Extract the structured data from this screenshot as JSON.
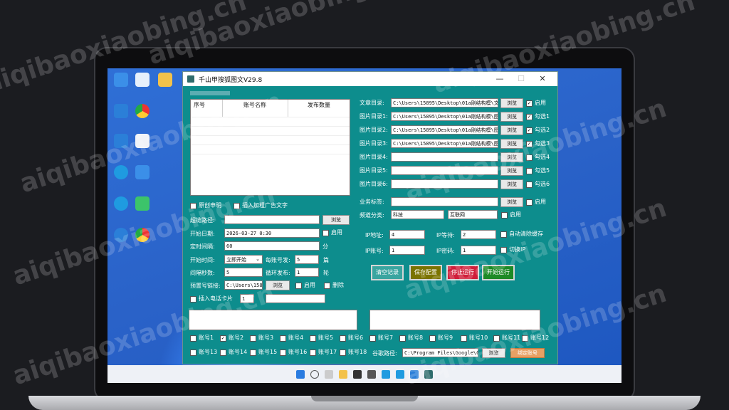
{
  "watermark": "aiqibaoxiaobing.cn",
  "window": {
    "title": "千山甲搜狐图文V29.8",
    "minimize": "—",
    "maximize": "☐",
    "close": "✕"
  },
  "table": {
    "headers": [
      "序号",
      "账号名称",
      "发布数量"
    ]
  },
  "left": {
    "original_label": "原创申明",
    "insert_ad_label": "插入加粗广告文字",
    "link_path_label": "超链路径:",
    "browse": "浏览",
    "start_date_label": "开始日期:",
    "start_date_value": "2026-03-27  0:30",
    "enable": "启用",
    "timer_label": "定时间隔:",
    "timer_value": "60",
    "minute_unit": "分",
    "start_time_label": "开始时间:",
    "start_time_value": "立即开始",
    "per_account_label": "每账号发:",
    "per_account_value": "5",
    "piece_unit": "篇",
    "interval_label": "间隔秒数:",
    "interval_value": "5",
    "loop_label": "循环发布:",
    "loop_value": "1",
    "round_unit": "轮",
    "preset_link_label": "预置号链接:",
    "preset_link_value": "C:\\Users\\1589",
    "delete": "删除",
    "insert_phone_label": "插入电话卡片",
    "phone_value": "1"
  },
  "right": {
    "article_dir_label": "文章目录:",
    "article_dir_value": "C:\\Users\\15895\\Desktop\\01a刚结构模\\文",
    "img_dirs": [
      {
        "label": "图片目录1:",
        "value": "C:\\Users\\15895\\Desktop\\01a刚结构模\\图",
        "check": "勾选1",
        "on": true
      },
      {
        "label": "图片目录2:",
        "value": "C:\\Users\\15895\\Desktop\\01a刚结构模\\图",
        "check": "勾选2",
        "on": true
      },
      {
        "label": "图片目录3:",
        "value": "C:\\Users\\15895\\Desktop\\01a刚结构模\\图",
        "check": "勾选3",
        "on": true
      },
      {
        "label": "图片目录4:",
        "value": "",
        "check": "勾选4",
        "on": false
      },
      {
        "label": "图片目录5:",
        "value": "",
        "check": "勾选5",
        "on": false
      },
      {
        "label": "图片目录6:",
        "value": "",
        "check": "勾选6",
        "on": false
      }
    ],
    "tag_label": "业务标签:",
    "channel_label": "频道分类:",
    "channel_value1": "科技",
    "channel_value2": "互联网",
    "ip_addr_label": "IP地址:",
    "ip_addr_value": "4",
    "ip_wait_label": "IP等待:",
    "ip_wait_value": "2",
    "auto_clear_label": "自动清除缓存",
    "ip_account_label": "IP账号:",
    "ip_account_value": "1",
    "ip_password_label": "IP密码:",
    "ip_password_value": "1",
    "switch_ip_label": "切换IP",
    "btn_clear": "清空记录",
    "btn_save": "保存配置",
    "btn_stop": "停止运行",
    "btn_start": "开始运行",
    "colors": {
      "clear": "#3aa5a0",
      "save": "#7a7300",
      "stop": "#d01e3a",
      "start": "#1e8a26"
    }
  },
  "accounts": [
    {
      "label": "账号1",
      "on": false
    },
    {
      "label": "账号2",
      "on": true
    },
    {
      "label": "账号3",
      "on": false
    },
    {
      "label": "账号4",
      "on": false
    },
    {
      "label": "账号5",
      "on": false
    },
    {
      "label": "账号6",
      "on": false
    },
    {
      "label": "账号7",
      "on": false
    },
    {
      "label": "账号8",
      "on": false
    },
    {
      "label": "账号9",
      "on": false
    },
    {
      "label": "账号10",
      "on": false
    },
    {
      "label": "账号11",
      "on": false
    },
    {
      "label": "账号12",
      "on": false
    },
    {
      "label": "账号13",
      "on": false
    },
    {
      "label": "账号14",
      "on": false
    },
    {
      "label": "账号15",
      "on": false
    },
    {
      "label": "账号16",
      "on": false
    },
    {
      "label": "账号17",
      "on": false
    },
    {
      "label": "账号18",
      "on": false
    }
  ],
  "bottom": {
    "chrome_path_label": "谷歌路径:",
    "chrome_path_value": "C:\\Program Files\\Google\\C",
    "bind_account": "绑定账号"
  }
}
